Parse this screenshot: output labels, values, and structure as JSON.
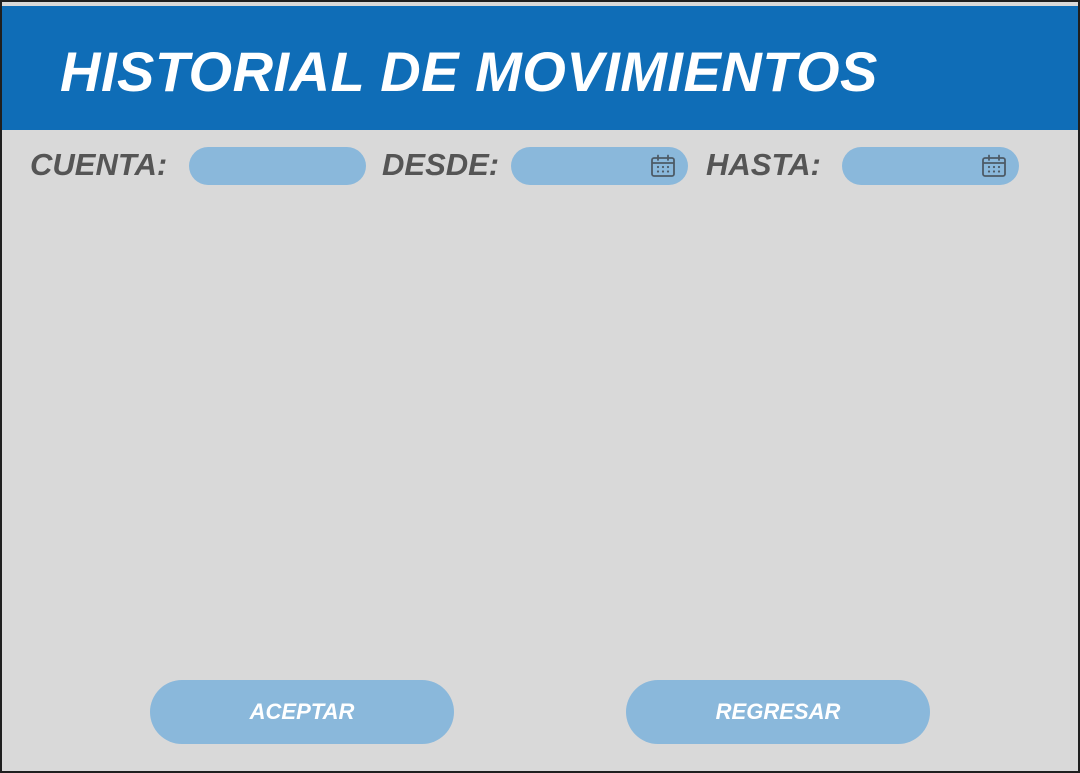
{
  "header": {
    "title": "HISTORIAL DE MOVIMIENTOS"
  },
  "filters": {
    "cuenta_label": "CUENTA:",
    "cuenta_value": "",
    "desde_label": "DESDE:",
    "desde_value": "",
    "hasta_label": "HASTA:",
    "hasta_value": "",
    "calendar_icon": "calendar-icon"
  },
  "actions": {
    "accept_label": "ACEPTAR",
    "back_label": "REGRESAR"
  },
  "colors": {
    "header_bg": "#0f6db7",
    "panel_bg": "#d9d9d9",
    "field_bg": "#8ab8db",
    "label_text": "#555555",
    "title_text": "#ffffff"
  }
}
